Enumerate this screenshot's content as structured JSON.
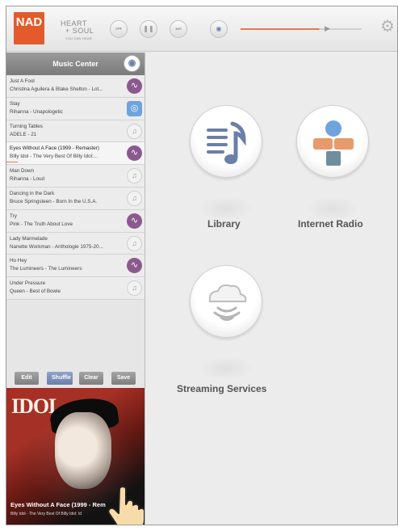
{
  "topbar": {
    "logo": "NAD",
    "brand_line1": "HEART",
    "brand_line2": "+ SOUL",
    "brand_line3": "YOU CAN HEAR",
    "prev_icon": "previous-icon",
    "pause_icon": "pause-icon",
    "next_icon": "next-icon",
    "zone_icon": "zone-icon",
    "volume_level": 0.65,
    "settings_icon": "gear-icon"
  },
  "sidebar": {
    "title": "Music Center",
    "queue": [
      {
        "title": "Just A Fool",
        "subtitle": "Christina Aguilera & Blake Shelton - Lot...",
        "source": "purple"
      },
      {
        "title": "Stay",
        "subtitle": "Rihanna - Unapologetic",
        "source": "blue"
      },
      {
        "title": "Turning Tables",
        "subtitle": "ADELE - 21",
        "source": "gray"
      },
      {
        "title": "Eyes Without A Face (1999 - Remaster)",
        "subtitle": "Billy Idol - The Very Best Of Billy Idol:...",
        "source": "purple"
      },
      {
        "title": "Man Down",
        "subtitle": "Rihanna - Loud",
        "source": "gray"
      },
      {
        "title": "Dancing in the Dark",
        "subtitle": "Bruce Springsteen - Born In the U.S.A.",
        "source": "gray"
      },
      {
        "title": "Try",
        "subtitle": "Pink - The Truth About Love",
        "source": "purple"
      },
      {
        "title": "Lady Marmelade",
        "subtitle": "Nanette Workman - Anthologie 1975-20...",
        "source": "gray"
      },
      {
        "title": "Ho Hey",
        "subtitle": "The Lumineers - The Lumineers",
        "source": "purple"
      },
      {
        "title": "Under Pressure",
        "subtitle": "Queen - Best of Bowie",
        "source": "gray"
      }
    ],
    "buttons": {
      "edit": "Edit",
      "shuffle": "Shuffle",
      "clear": "Clear",
      "save": "Save"
    },
    "now_playing": {
      "album_text": "IDOL",
      "title": "Eyes Without A Face (1999 - Rem",
      "subtitle": "Billy Idol - The Very Best Of Billy Idol: Id"
    }
  },
  "main": {
    "library_label": "Library",
    "internet_radio_label": "Internet Radio",
    "streaming_label": "Streaming Services"
  },
  "colors": {
    "accent": "#e35a2c",
    "purple": "#8a5a8e",
    "blue": "#6ea3dc"
  }
}
